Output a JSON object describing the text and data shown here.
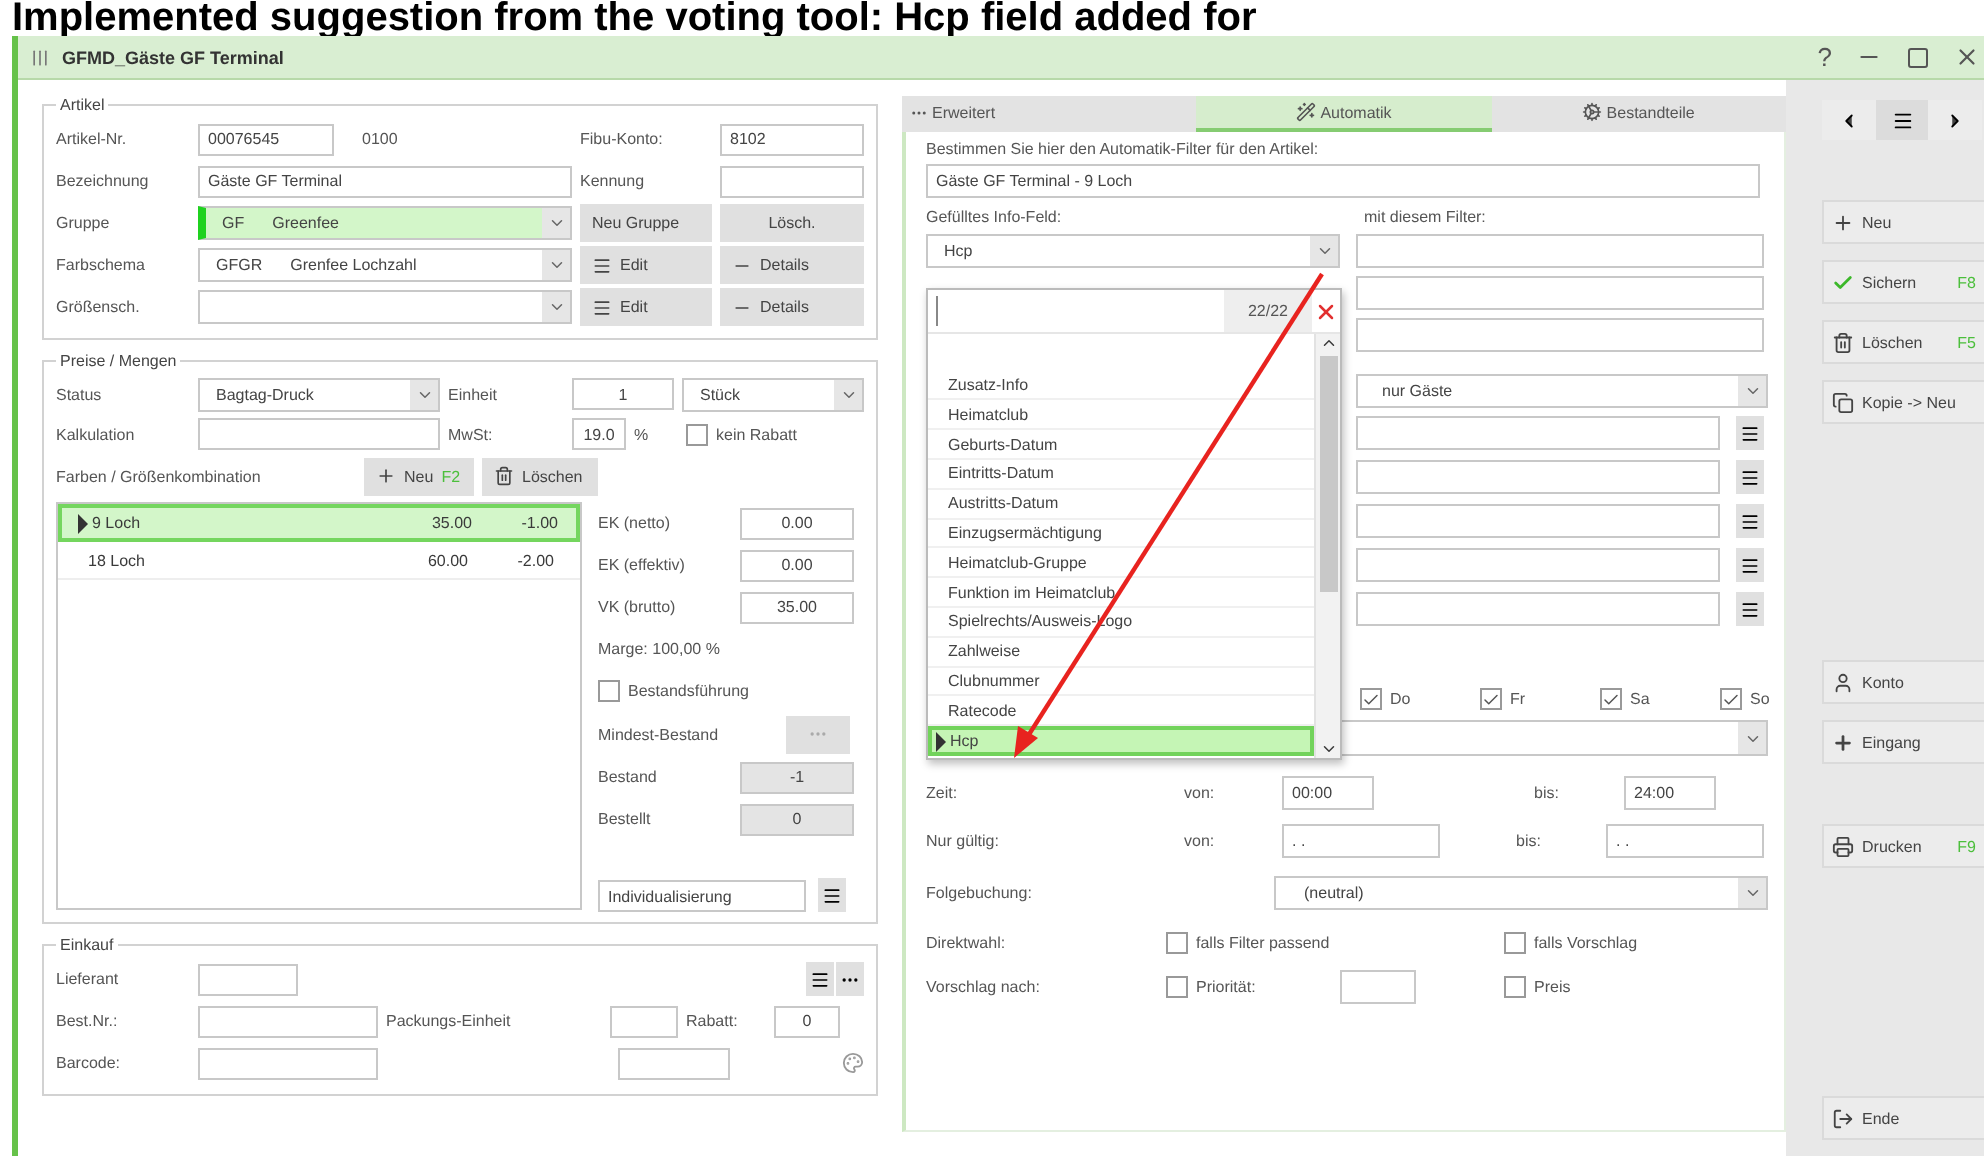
{
  "caption": "Implemented suggestion from the voting tool: Hcp field added for",
  "window": {
    "title": "GFMD_Gäste GF Terminal",
    "help": "?"
  },
  "artikel": {
    "title": "Artikel",
    "nr": {
      "label": "Artikel-Nr.",
      "value": "00076545",
      "suffix": "0100"
    },
    "fibu": {
      "label": "Fibu-Konto:",
      "value": "8102"
    },
    "bezeichnung": {
      "label": "Bezeichnung",
      "value": "Gäste GF Terminal"
    },
    "kennung": {
      "label": "Kennung"
    },
    "combos": [
      {
        "label": "Gruppe",
        "code": "GF",
        "name": "Greenfee",
        "highlighted": true,
        "buttons": [
          {
            "kind": "plain",
            "label": "Neu Gruppe"
          },
          {
            "kind": "plain",
            "label": "Lösch."
          }
        ]
      },
      {
        "label": "Farbschema",
        "code": "GFGR",
        "name": "Grenfee Lochzahl",
        "highlighted": false,
        "buttons": [
          {
            "kind": "edit",
            "label": "Edit"
          },
          {
            "kind": "details",
            "label": "Details"
          }
        ]
      },
      {
        "label": "Größensch.",
        "highlighted": false,
        "buttons": [
          {
            "kind": "edit",
            "label": "Edit"
          },
          {
            "kind": "details",
            "label": "Details"
          }
        ]
      }
    ]
  },
  "preise": {
    "title": "Preise / Mengen",
    "status": {
      "label": "Status",
      "value": "Bagtag-Druck"
    },
    "einheit": {
      "label": "Einheit",
      "value": "1",
      "unit": "Stück"
    },
    "kalkulation": {
      "label": "Kalkulation"
    },
    "mwst": {
      "label": "MwSt:",
      "value": "19.0",
      "unit": "%"
    },
    "kein_rabatt": {
      "label": "kein Rabatt",
      "checked": false
    },
    "combos_label": "Farben / Größenkombination",
    "new_button": {
      "label": "Neu",
      "key": "F2"
    },
    "delete_button": {
      "label": "Löschen"
    },
    "rows": [
      {
        "name": "9 Loch",
        "price": "35.00",
        "discount": "-1.00",
        "selected": true
      },
      {
        "name": "18 Loch",
        "price": "60.00",
        "discount": "-2.00",
        "selected": false
      }
    ],
    "prices": [
      {
        "label": "EK (netto)",
        "value": "0.00"
      },
      {
        "label": "EK (effektiv)",
        "value": "0.00"
      },
      {
        "label": "VK (brutto)",
        "value": "35.00"
      }
    ],
    "marge": "Marge: 100,00 %",
    "bestandsfuehrung": {
      "label": "Bestandsführung",
      "checked": false
    },
    "mindest": {
      "label": "Mindest-Bestand"
    },
    "stock": [
      {
        "label": "Bestand",
        "value": "-1"
      },
      {
        "label": "Bestellt",
        "value": "0"
      }
    ],
    "individualisierung": "Individualisierung"
  },
  "einkauf": {
    "title": "Einkauf",
    "lieferant": "Lieferant",
    "best_nr": "Best.Nr.:",
    "packung": "Packungs-Einheit",
    "rabatt": {
      "label": "Rabatt:",
      "value": "0"
    },
    "barcode": "Barcode:"
  },
  "tabs": [
    {
      "label": "Erweitert",
      "kind": "dots",
      "selected": false
    },
    {
      "label": "Automatik",
      "kind": "wand",
      "selected": true
    },
    {
      "label": "Bestandteile",
      "kind": "gear",
      "selected": false
    }
  ],
  "automatik": {
    "intro": "Bestimmen Sie hier den Automatik-Filter für den Artikel:",
    "name": "Gäste GF Terminal - 9 Loch",
    "info_label": "Gefülltes Info-Feld:",
    "info_value": "Hcp",
    "filter_label": "mit diesem Filter:",
    "guests": "nur Gäste",
    "days": [
      {
        "label": "Do",
        "checked": true
      },
      {
        "label": "Fr",
        "checked": true
      },
      {
        "label": "Sa",
        "checked": true
      },
      {
        "label": "So",
        "checked": true
      }
    ],
    "zeit": {
      "label": "Zeit:",
      "from_label": "von:",
      "from": "00:00",
      "to_label": "bis:",
      "to": "24:00"
    },
    "gueltig": {
      "label": "Nur gültig:",
      "from_label": "von:",
      "from": ". .",
      "to_label": "bis:",
      "to": ". ."
    },
    "folgebuchung": {
      "label": "Folgebuchung:",
      "value": "(neutral)"
    },
    "direktwahl": {
      "label": "Direktwahl:",
      "options": [
        {
          "label": "falls Filter passend",
          "checked": false
        },
        {
          "label": "falls Vorschlag",
          "checked": false
        }
      ]
    },
    "vorschlag": {
      "label": "Vorschlag nach:",
      "options": [
        {
          "label": "Priorität:",
          "checked": false
        },
        {
          "label": "Preis",
          "checked": false
        }
      ]
    }
  },
  "dropdown": {
    "counter": "22/22",
    "items": [
      {
        "label": "Zusatz-Info",
        "selected": false
      },
      {
        "label": "Heimatclub",
        "selected": false
      },
      {
        "label": "Geburts-Datum",
        "selected": false
      },
      {
        "label": "Eintritts-Datum",
        "selected": false
      },
      {
        "label": "Austritts-Datum",
        "selected": false
      },
      {
        "label": "Einzugsermächtigung",
        "selected": false
      },
      {
        "label": "Heimatclub-Gruppe",
        "selected": false
      },
      {
        "label": "Funktion im Heimatclub",
        "selected": false
      },
      {
        "label": "Spielrechts/Ausweis-Logo",
        "selected": false
      },
      {
        "label": "Zahlweise",
        "selected": false
      },
      {
        "label": "Clubnummer",
        "selected": false
      },
      {
        "label": "Ratecode",
        "selected": false
      },
      {
        "label": "Hcp",
        "selected": true
      }
    ]
  },
  "sidebar": {
    "groups": [
      [
        {
          "kind": "new",
          "label": "Neu"
        },
        {
          "kind": "save",
          "label": "Sichern",
          "key": "F8"
        },
        {
          "kind": "delete",
          "label": "Löschen",
          "key": "F5"
        },
        {
          "kind": "copy",
          "label": "Kopie -> Neu"
        }
      ],
      [
        {
          "kind": "account",
          "label": "Konto"
        },
        {
          "kind": "receipt",
          "label": "Eingang"
        }
      ],
      [
        {
          "kind": "print",
          "label": "Drucken",
          "key": "F9"
        }
      ],
      [
        {
          "kind": "exit",
          "label": "Ende"
        }
      ]
    ]
  }
}
